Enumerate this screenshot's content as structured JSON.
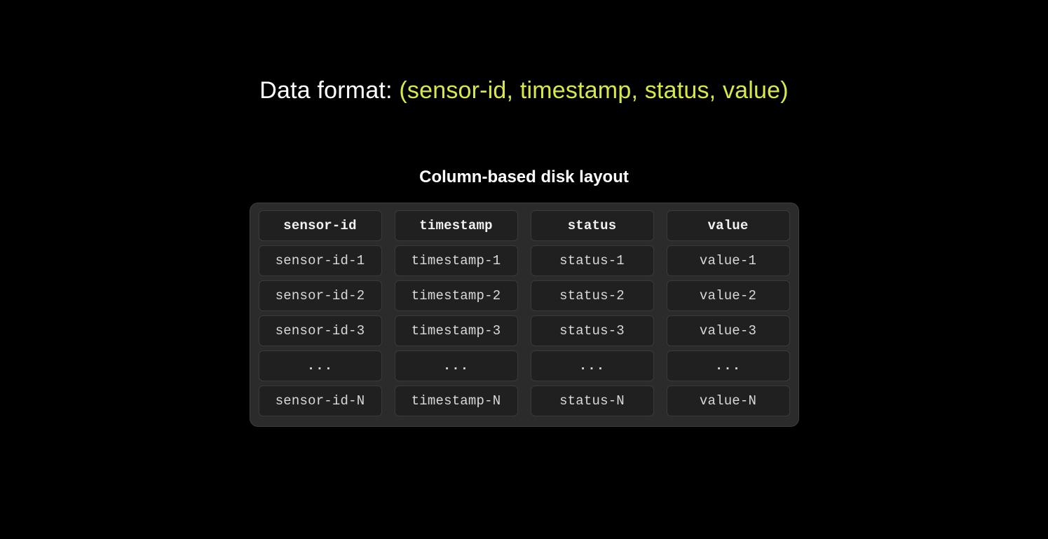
{
  "title": {
    "prefix": "Data format: ",
    "tuple": "(sensor-id, timestamp, status, value)"
  },
  "subtitle": "Column-based disk layout",
  "ellipsis": "...",
  "columns": [
    {
      "header": "sensor-id",
      "cells": [
        "sensor-id-1",
        "sensor-id-2",
        "sensor-id-3",
        "...",
        "sensor-id-N"
      ]
    },
    {
      "header": "timestamp",
      "cells": [
        "timestamp-1",
        "timestamp-2",
        "timestamp-3",
        "...",
        "timestamp-N"
      ]
    },
    {
      "header": "status",
      "cells": [
        "status-1",
        "status-2",
        "status-3",
        "...",
        "status-N"
      ]
    },
    {
      "header": "value",
      "cells": [
        "value-1",
        "value-2",
        "value-3",
        "...",
        "value-N"
      ]
    }
  ]
}
